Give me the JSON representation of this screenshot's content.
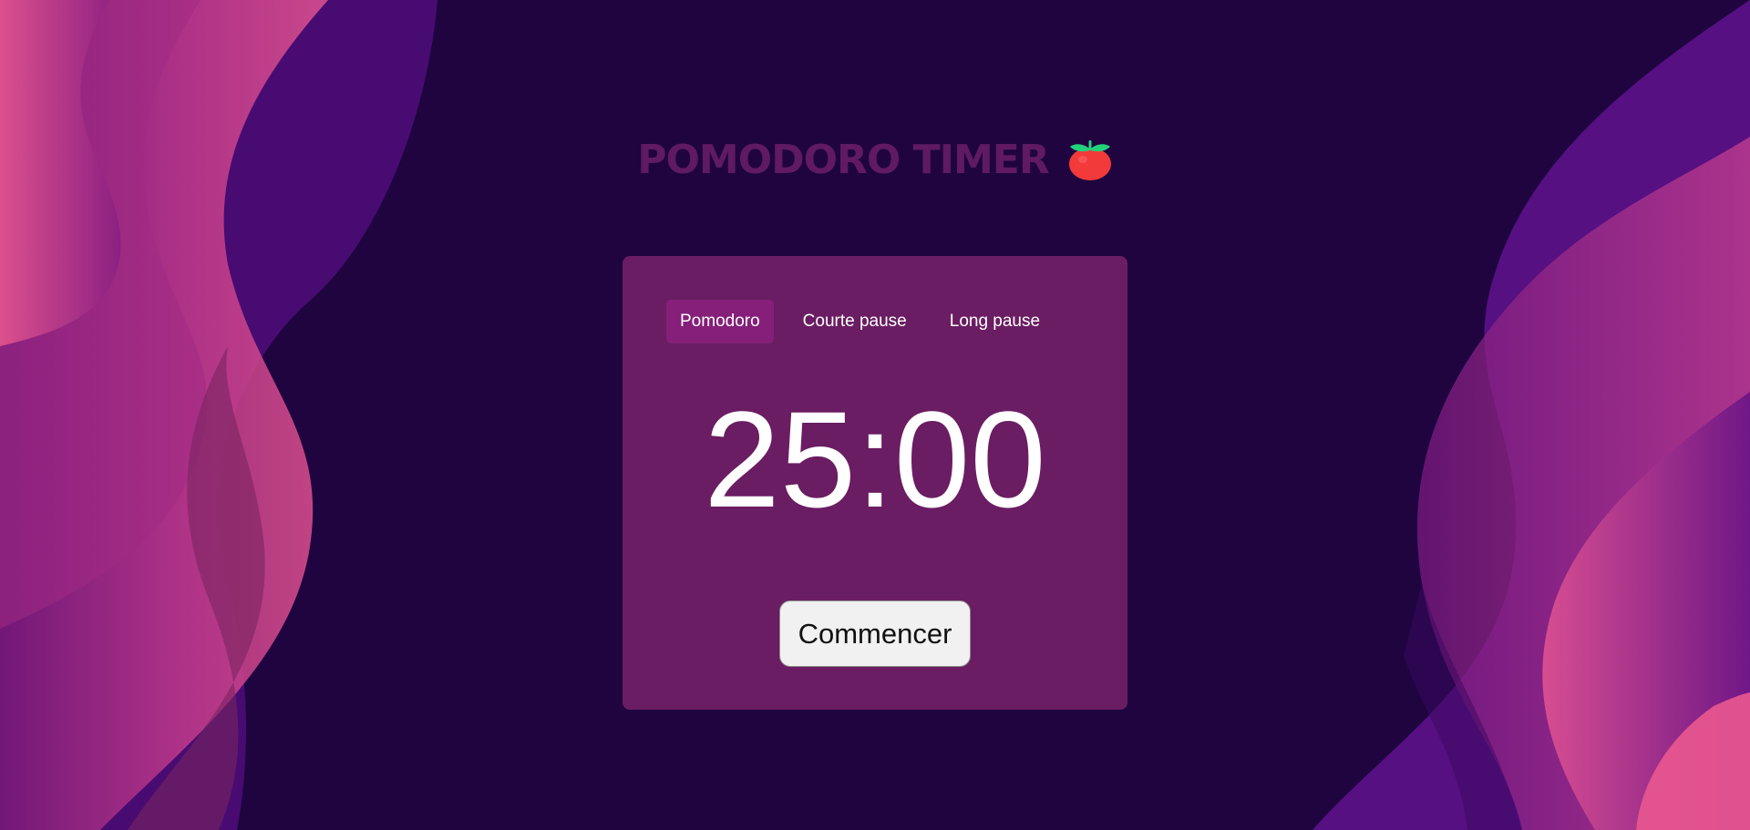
{
  "header": {
    "title": "POMODORO TIMER"
  },
  "timer": {
    "tabs": [
      {
        "label": "Pomodoro",
        "active": true
      },
      {
        "label": "Courte pause",
        "active": false
      },
      {
        "label": "Long pause",
        "active": false
      }
    ],
    "time": "25:00",
    "start_label": "Commencer"
  },
  "colors": {
    "background": "#1f0440",
    "card": "#6a1d62",
    "active_tab": "#851f79",
    "title": "#5f1a63",
    "tomato": "#f23a3a",
    "leaf": "#22d17a"
  }
}
